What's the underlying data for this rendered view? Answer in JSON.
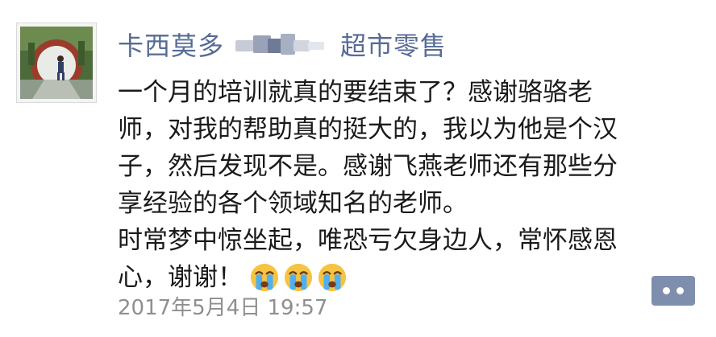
{
  "post": {
    "username_visible_left": "卡西莫多",
    "username_visible_right": "超市零售",
    "content_lines": [
      "一个月的培训就真的要结束了？感谢骆骆老",
      "师，对我的帮助真的挺大的，我以为他是个汉",
      "子，然后发现不是。感谢飞燕老师还有那些分",
      "享经验的各个领域知名的老师。",
      "时常梦中惊坐起，唯恐亏欠身边人，常怀感恩",
      "心，谢谢！"
    ],
    "emojis": [
      "crying-face-icon",
      "crying-face-icon",
      "crying-face-icon"
    ],
    "timestamp": "2017年5月4日 19:57",
    "comment_button_icon": "comment-dots-icon"
  },
  "colors": {
    "username": "#576b95",
    "text": "#1a1a1a",
    "timestamp": "#8f8f8f",
    "comment_button": "#7e8fad"
  }
}
